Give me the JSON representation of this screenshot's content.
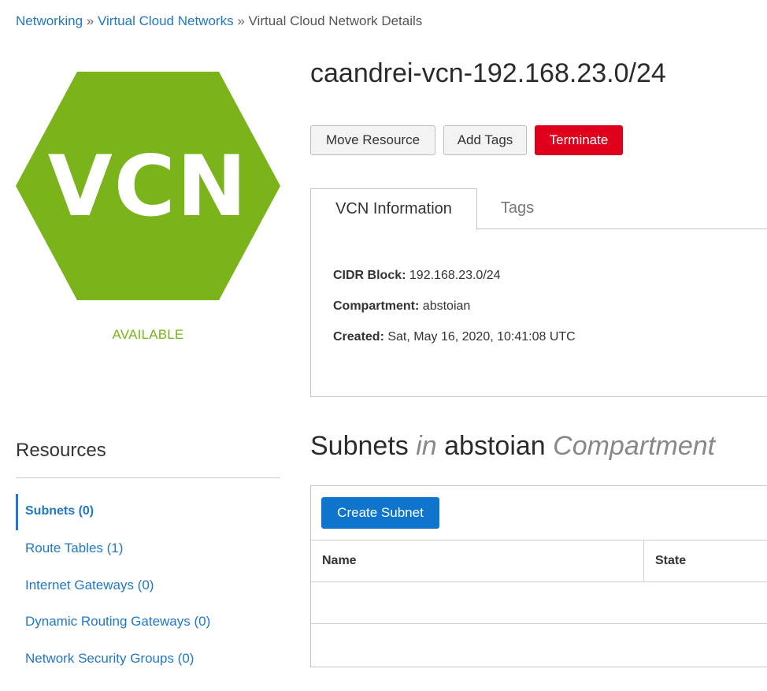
{
  "breadcrumb": {
    "items": [
      "Networking",
      "Virtual Cloud Networks",
      "Virtual Cloud Network Details"
    ],
    "separator": "»"
  },
  "resource_icon": {
    "label": "VCN",
    "color": "#7ab41a",
    "status": "AVAILABLE",
    "status_color": "#7ab41a"
  },
  "page_title": "caandrei-vcn-192.168.23.0/24",
  "actions": {
    "move": "Move Resource",
    "add_tags": "Add Tags",
    "terminate": "Terminate"
  },
  "tabs": [
    "VCN Information",
    "Tags"
  ],
  "info": {
    "cidr_label": "CIDR Block:",
    "cidr_value": "192.168.23.0/24",
    "compartment_label": "Compartment:",
    "compartment_value": "abstoian",
    "created_label": "Created:",
    "created_value": "Sat, May 16, 2020, 10:41:08 UTC"
  },
  "resources": {
    "title": "Resources",
    "items": [
      "Subnets (0)",
      "Route Tables (1)",
      "Internet Gateways (0)",
      "Dynamic Routing Gateways (0)",
      "Network Security Groups (0)"
    ],
    "active_index": 0
  },
  "subnets": {
    "heading_word": "Subnets",
    "heading_in": "in",
    "compartment": "abstoian",
    "heading_suffix": "Compartment",
    "create_label": "Create Subnet",
    "columns": [
      "Name",
      "State"
    ]
  },
  "colors": {
    "link": "#1f78c8",
    "terminate": "#e0001b",
    "primary": "#0f75cc",
    "vcn_green": "#7ab41a"
  }
}
